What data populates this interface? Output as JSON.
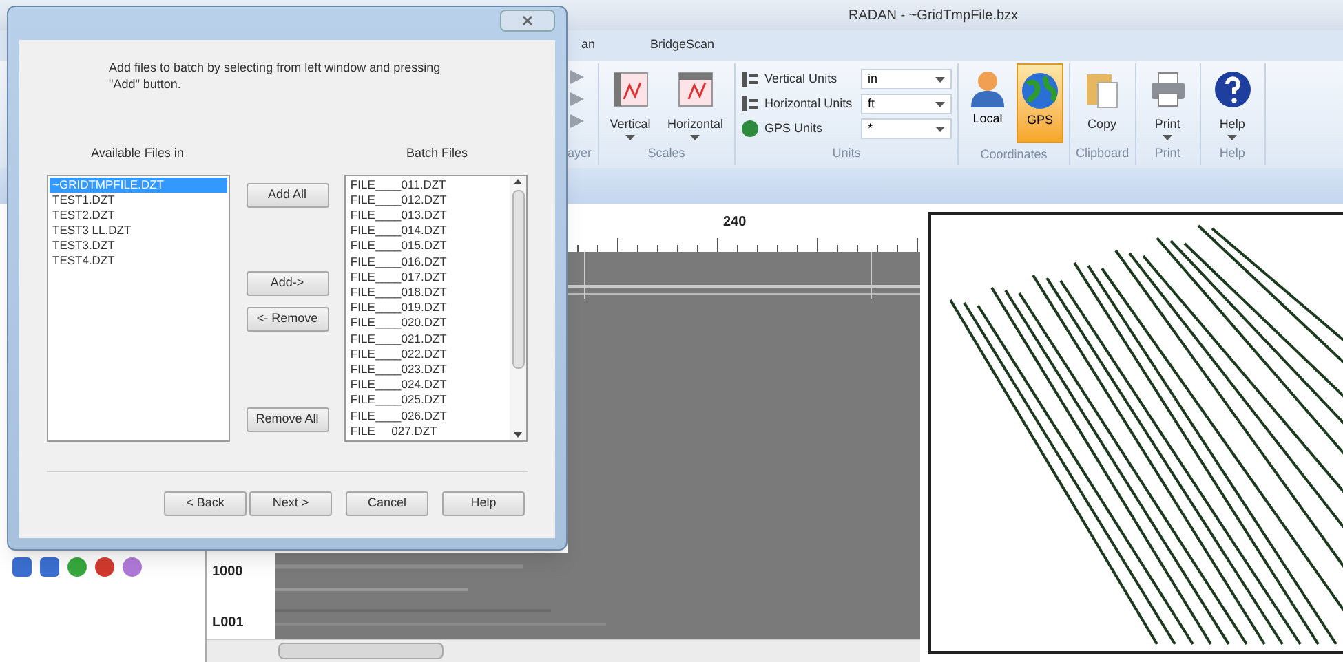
{
  "window": {
    "title": "RADAN - ~GridTmpFile.bzx"
  },
  "tabs": [
    {
      "label": "an",
      "selected": false
    },
    {
      "label": "BridgeScan",
      "selected": false
    }
  ],
  "ribbon": {
    "groups": [
      {
        "kind": "player",
        "label": "ayer"
      },
      {
        "kind": "scales",
        "label": "Scales",
        "buttons": [
          "Vertical",
          "Horizontal"
        ]
      },
      {
        "kind": "units",
        "label": "Units",
        "fields": [
          {
            "label": "Vertical Units",
            "value": "in"
          },
          {
            "label": "Horizontal Units",
            "value": "ft"
          },
          {
            "label": "GPS Units",
            "value": "*"
          }
        ]
      },
      {
        "kind": "coordinates",
        "label": "Coordinates",
        "buttons": [
          {
            "label": "Local",
            "selected": false
          },
          {
            "label": "GPS",
            "selected": true
          }
        ]
      },
      {
        "kind": "clipboard",
        "label": "Clipboard",
        "buttons": [
          "Copy"
        ]
      },
      {
        "kind": "print",
        "label": "Print",
        "buttons": [
          "Print"
        ]
      },
      {
        "kind": "help",
        "label": "Help",
        "buttons": [
          "Help"
        ]
      }
    ]
  },
  "radargram": {
    "ruler_label": "240",
    "axis_labels": [
      "1000",
      "L001"
    ]
  },
  "dialog": {
    "instruction": "Add files to batch by selecting from left window and pressing \"Add\" button.",
    "available_title": "Available Files in",
    "batch_title": "Batch Files",
    "available_files": [
      {
        "name": "~GRIDTMPFILE.DZT",
        "selected": true
      },
      {
        "name": "TEST1.DZT",
        "selected": false
      },
      {
        "name": "TEST2.DZT",
        "selected": false
      },
      {
        "name": "TEST3 LL.DZT",
        "selected": false
      },
      {
        "name": "TEST3.DZT",
        "selected": false
      },
      {
        "name": "TEST4.DZT",
        "selected": false
      }
    ],
    "batch_files": [
      "FILE____011.DZT",
      "FILE____012.DZT",
      "FILE____013.DZT",
      "FILE____014.DZT",
      "FILE____015.DZT",
      "FILE____016.DZT",
      "FILE____017.DZT",
      "FILE____018.DZT",
      "FILE____019.DZT",
      "FILE____020.DZT",
      "FILE____021.DZT",
      "FILE____022.DZT",
      "FILE____023.DZT",
      "FILE____024.DZT",
      "FILE____025.DZT",
      "FILE____026.DZT",
      "FILE     027.DZT"
    ],
    "move_buttons": [
      "Add All",
      "Add->",
      "<- Remove",
      "Remove All"
    ],
    "footer_buttons": [
      "< Back",
      "Next >",
      "Cancel",
      "Help"
    ]
  }
}
